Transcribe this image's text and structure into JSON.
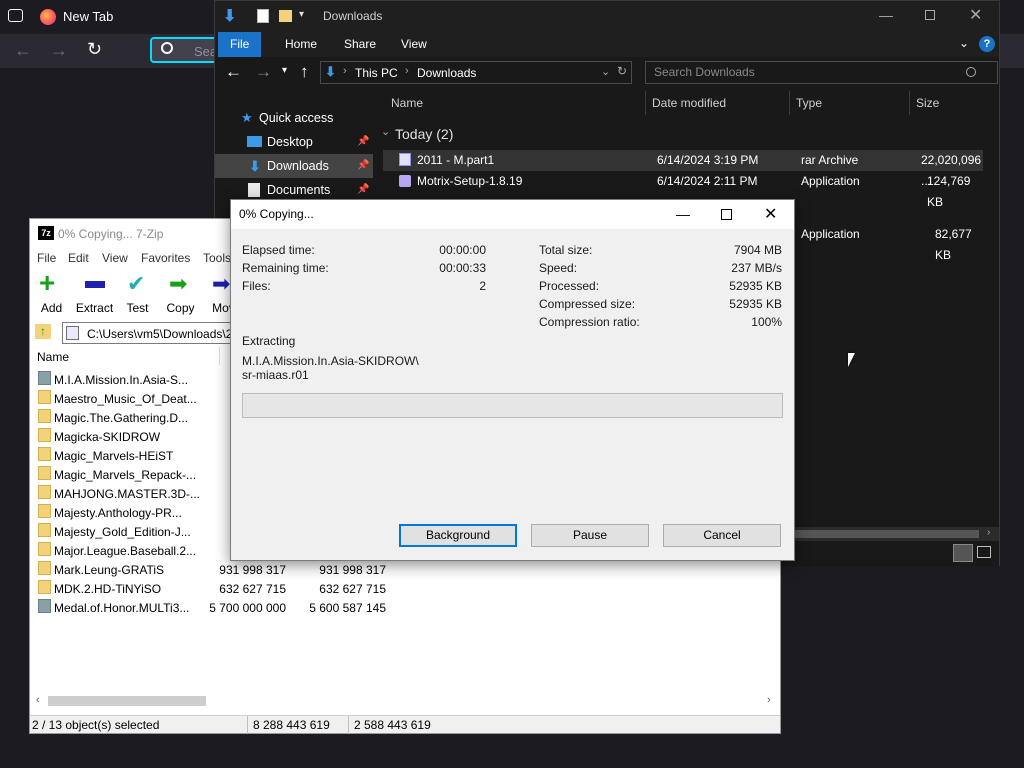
{
  "browser": {
    "tab_title": "New Tab",
    "search_placeholder": "Sea"
  },
  "explorer": {
    "title": "Downloads",
    "ribbon_tabs": [
      "File",
      "Home",
      "Share",
      "View"
    ],
    "address": {
      "segments": [
        "This PC",
        "Downloads"
      ]
    },
    "search_placeholder": "Search Downloads",
    "nav": [
      {
        "label": "Quick access"
      },
      {
        "label": "Desktop"
      },
      {
        "label": "Downloads"
      },
      {
        "label": "Documents"
      }
    ],
    "columns": [
      "Name",
      "Date modified",
      "Type",
      "Size"
    ],
    "group_label": "Today (2)",
    "files": [
      {
        "name": "2011 - M.part1",
        "date": "6/14/2024 3:19 PM",
        "type": "rar Archive",
        "size": "22,020,096 ..."
      },
      {
        "name": "Motrix-Setup-1.8.19",
        "date": "6/14/2024 2:11 PM",
        "type": "Application",
        "size": "124,769 KB"
      }
    ],
    "extra_row": {
      "type": "Application",
      "size": "82,677 KB"
    }
  },
  "sevenzip": {
    "title": "0% Copying... 7-Zip",
    "menu": [
      "File",
      "Edit",
      "View",
      "Favorites",
      "Tools"
    ],
    "tools": [
      "Add",
      "Extract",
      "Test",
      "Copy",
      "Mov"
    ],
    "path": "C:\\Users\\vm5\\Downloads\\2",
    "column_name": "Name",
    "rows": [
      {
        "name": "M.I.A.Mission.In.Asia-S...",
        "size": "2 5",
        "packed": ""
      },
      {
        "name": "Maestro_Music_Of_Deat...",
        "size": "7",
        "packed": ""
      },
      {
        "name": "Magic.The.Gathering.D...",
        "size": "7",
        "packed": ""
      },
      {
        "name": "Magicka-SKIDROW",
        "size": "1 0",
        "packed": ""
      },
      {
        "name": "Magic_Marvels-HEiST",
        "size": "1",
        "packed": ""
      },
      {
        "name": "Magic_Marvels_Repack-...",
        "size": "2",
        "packed": ""
      },
      {
        "name": "MAHJONG.MASTER.3D-...",
        "size": "2",
        "packed": ""
      },
      {
        "name": "Majesty.Anthology-PR...",
        "size": "3 9",
        "packed": ""
      },
      {
        "name": "Majesty_Gold_Edition-J...",
        "size": "5",
        "packed": ""
      },
      {
        "name": "Major.League.Baseball.2...",
        "size": "5 1",
        "packed": ""
      },
      {
        "name": "Mark.Leung-GRATiS",
        "size": "931 998 317",
        "packed": "931 998 317"
      },
      {
        "name": "MDK.2.HD-TiNYiSO",
        "size": "632 627 715",
        "packed": "632 627 715"
      },
      {
        "name": "Medal.of.Honor.MULTi3...",
        "size": "5 700 000 000",
        "packed": "5 600 587 145"
      }
    ],
    "status": {
      "selected": "2 / 13 object(s) selected",
      "size": "8 288 443 619",
      "packed": "2 588 443 619"
    }
  },
  "copy_dialog": {
    "title": "0% Copying...",
    "elapsed_label": "Elapsed time:",
    "elapsed_value": "00:00:00",
    "remaining_label": "Remaining time:",
    "remaining_value": "00:00:33",
    "files_label": "Files:",
    "files_value": "2",
    "total_label": "Total size:",
    "total_value": "7904 MB",
    "speed_label": "Speed:",
    "speed_value": "237 MB/s",
    "processed_label": "Processed:",
    "processed_value": "52935 KB",
    "compressed_label": "Compressed size:",
    "compressed_value": "52935 KB",
    "ratio_label": "Compression ratio:",
    "ratio_value": "100%",
    "extracting_label": "Extracting",
    "path_line1": "M.I.A.Mission.In.Asia-SKIDROW\\",
    "path_line2": "sr-miaas.r01",
    "progress": 0.0,
    "buttons": {
      "background": "Background",
      "pause": "Pause",
      "cancel": "Cancel"
    }
  }
}
